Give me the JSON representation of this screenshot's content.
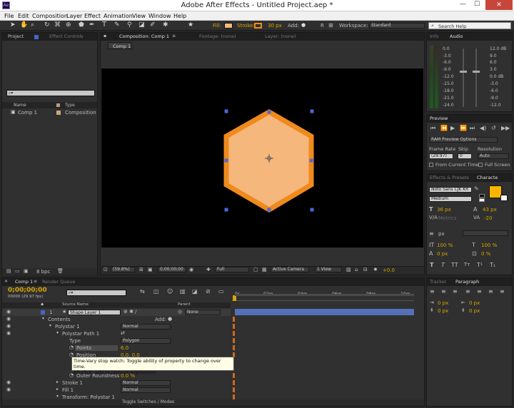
{
  "window": {
    "title": "Adobe After Effects - Untitled Project.aep *"
  },
  "menu": [
    "File",
    "Edit",
    "Composition",
    "Layer",
    "Effect",
    "Animation",
    "View",
    "Window",
    "Help"
  ],
  "toolbar": {
    "fill_label": "Fill:",
    "stroke_label": "Stroke:",
    "stroke_width": "30 px",
    "add_label": "Add:",
    "workspace_label": "Workspace:",
    "workspace_value": "Standard",
    "search_placeholder": "Search Help",
    "fill_color": "#f5b77b",
    "stroke_color": "#f08a1c"
  },
  "project_panel": {
    "tab_project": "Project",
    "tab_effect_controls": "Effect Controls",
    "col_name": "Name",
    "col_type": "Type",
    "item_name": "Comp 1",
    "item_type": "Composition",
    "bpc": "8 bpc"
  },
  "composition_panel": {
    "tab_label": "Composition: Comp 1",
    "footage_label": "Footage: (none)",
    "layer_label": "Layer: (none)",
    "comp_tab": "Comp 1",
    "zoom": "(59.8%)",
    "timecode": "0;00;00;00",
    "resolution": "Full",
    "camera": "Active Camera",
    "views": "1 View",
    "exposure": "+0.0"
  },
  "info_panel": {
    "tab_info": "Info",
    "tab_audio": "Audio",
    "left_scale": [
      "0.0",
      "-3.0",
      "-6.0",
      "-9.0",
      "-12.0",
      "-15.0",
      "-18.0",
      "-21.0",
      "-24.0"
    ],
    "right_scale": [
      "12.0 dB",
      "9.0",
      "6.0",
      "3.0",
      "0.0 dB",
      "-3.0",
      "-6.0",
      "-9.0",
      "-12.0"
    ]
  },
  "preview_panel": {
    "tab": "Preview",
    "ram_options": "RAM Preview Options",
    "frame_rate_label": "Frame Rate",
    "skip_label": "Skip",
    "resolution_label": "Resolution",
    "frame_rate_value": "(29.97)",
    "skip_value": "0",
    "resolution_value": "Auto",
    "from_current": "From Current Time",
    "full_screen": "Full Screen"
  },
  "character_panel": {
    "tab_effects": "Effects & Presets",
    "tab_character": "Characte",
    "font": "Noto Sans CJK KR",
    "style": "Medium",
    "size": "36 px",
    "leading": "43 px",
    "tracking_kern": "Metrics",
    "tracking": "-20",
    "unit": "px",
    "vscale": "100 %",
    "hscale": "100 %",
    "baseline": "0 px",
    "tsume": "0 %"
  },
  "paragraph_panel": {
    "tab_tracker": "Tracker",
    "tab_paragraph": "Paragraph",
    "indent_values": [
      "0 px",
      "0 px",
      "0 px",
      "0 px"
    ]
  },
  "timeline": {
    "tab_comp": "Comp 1",
    "tab_render": "Render Queue",
    "timecode": "0;00;00;00",
    "fps": "00000 (29.97 fps)",
    "col_source": "Source Name",
    "col_parent": "Parent",
    "time_marks": [
      "0s",
      "02m",
      "04m",
      "06m",
      "08m",
      "10m"
    ],
    "layer_num": "1",
    "layer_name": "Shape Layer 1",
    "parent_value": "None",
    "toggle_label": "Toggle Switches / Modes",
    "rows": [
      {
        "label": "Contents",
        "value": "",
        "extra": "Add:"
      },
      {
        "label": "Polystar 1",
        "value": "Normal"
      },
      {
        "label": "Polystar Path 1",
        "value": ""
      },
      {
        "label": "Type",
        "value": "Polygon"
      },
      {
        "label": "Points",
        "value": "6.0"
      },
      {
        "label": "Position",
        "value": "0.0, 0.0"
      },
      {
        "label": "Outer Roundness",
        "value": "0.0 %"
      },
      {
        "label": "Stroke 1",
        "value": "Normal"
      },
      {
        "label": "Fill 1",
        "value": "Normal"
      },
      {
        "label": "Transform: Polystar 1",
        "value": ""
      }
    ],
    "tooltip_line1": "Time-Vary stop watch: Toggle ability of property to change over time.",
    "tooltip_line2": "Alt-click: add or remove expression."
  }
}
